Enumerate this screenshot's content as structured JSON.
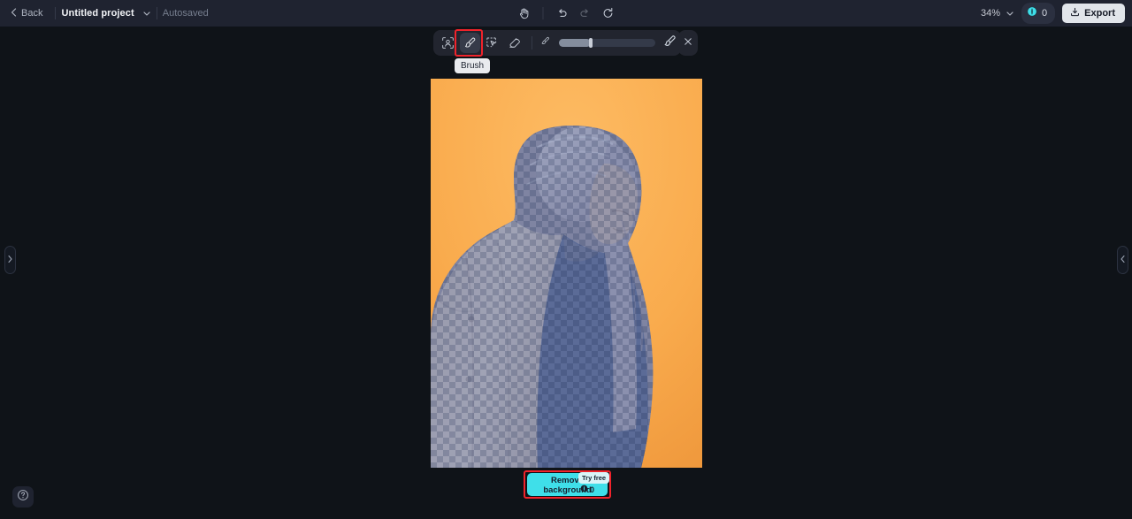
{
  "topbar": {
    "back_label": "Back",
    "project_name": "Untitled project",
    "save_status": "Autosaved",
    "zoom_label": "34%",
    "credits_count": "0",
    "export_label": "Export",
    "history_tools": [
      {
        "name": "pan-hand",
        "label": "Pan"
      },
      {
        "name": "undo",
        "label": "Undo"
      },
      {
        "name": "redo",
        "label": "Redo"
      },
      {
        "name": "reset",
        "label": "Reset"
      }
    ]
  },
  "toolbar": {
    "tools": [
      {
        "name": "select-subject",
        "label": "Select subject",
        "selected": false
      },
      {
        "name": "brush",
        "label": "Brush",
        "selected": true
      },
      {
        "name": "object-select",
        "label": "Object select",
        "selected": false
      },
      {
        "name": "eraser",
        "label": "Eraser",
        "selected": false
      }
    ],
    "brush_size_percent": 33,
    "min_size_label": "Small brush",
    "max_size_label": "Large brush",
    "close_label": "Close",
    "tooltip": "Brush"
  },
  "canvas": {
    "remove_background_label": "Remove background",
    "try_free_label": "Try free",
    "credit_cost": "0",
    "left_panel_toggle": "›",
    "right_panel_toggle": "‹",
    "help_label": "?"
  },
  "colors": {
    "accent": "#3fdfe9",
    "highlight": "#f0232b",
    "topbar_bg": "#1f2330",
    "canvas_bg": "#0f1318",
    "toolbar_bg": "#22252f",
    "image_background": "#fbb257",
    "mask_blue": "#3a5291"
  }
}
